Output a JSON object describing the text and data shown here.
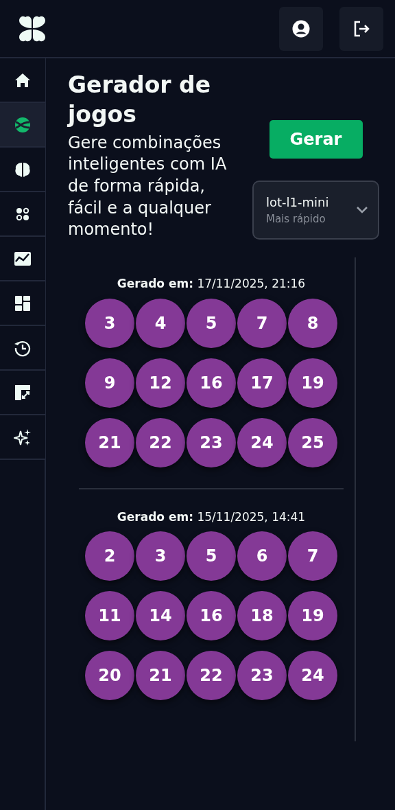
{
  "header": {
    "buttons": [
      {
        "kind": "profile"
      },
      {
        "kind": "logout"
      }
    ]
  },
  "sidebar": {
    "items": [
      {
        "selected": false
      },
      {
        "selected": true
      },
      {
        "selected": false
      },
      {
        "selected": false
      },
      {
        "selected": false
      },
      {
        "selected": false
      },
      {
        "selected": false
      },
      {
        "selected": false
      },
      {
        "selected": false
      }
    ]
  },
  "title": "Gerador de jogos",
  "description": "Gere combinações inteligentes com IA de forma rápida, fácil e a qualquer momento!",
  "generate_button": "Gerar",
  "model_select": {
    "value": "lot-l1-mini",
    "hint": "Mais rápido"
  },
  "games": [
    {
      "label": "Gerado em:",
      "date": "17/11/2025, 21:16",
      "numbers": [
        "3",
        "4",
        "5",
        "7",
        "8",
        "9",
        "12",
        "16",
        "17",
        "19",
        "21",
        "22",
        "23",
        "24",
        "25"
      ]
    },
    {
      "label": "Gerado em:",
      "date": "15/11/2025, 14:41",
      "numbers": [
        "2",
        "3",
        "5",
        "6",
        "7",
        "11",
        "14",
        "16",
        "18",
        "19",
        "20",
        "21",
        "22",
        "23",
        "24"
      ]
    }
  ]
}
